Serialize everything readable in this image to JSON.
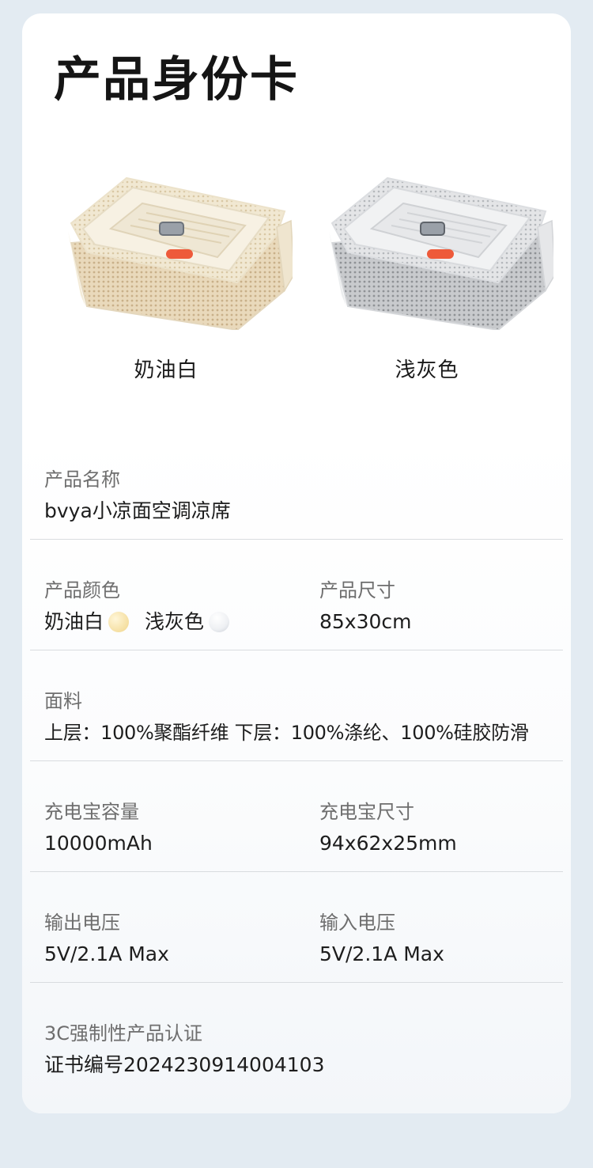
{
  "header": {
    "title": "产品身份卡"
  },
  "colors": {
    "page_bg": "#e3ebf2",
    "card_bg": "#ffffff",
    "cream_swatch": "#f5dfa2",
    "grey_swatch": "#e6e9ee",
    "button_orange": "#ee5a3a"
  },
  "products": [
    {
      "name": "奶油白",
      "image": "cream-cooling-mat-image"
    },
    {
      "name": "浅灰色",
      "image": "grey-cooling-mat-image"
    }
  ],
  "specs": {
    "product_name": {
      "label": "产品名称",
      "value": "bvya小凉面空调凉席"
    },
    "product_color": {
      "label": "产品颜色",
      "option1": "奶油白",
      "option2": "浅灰色"
    },
    "product_size": {
      "label": "产品尺寸",
      "value": "85x30cm"
    },
    "fabric": {
      "label": "面料",
      "value": "上层：100%聚酯纤维 下层：100%涤纶、100%硅胶防滑"
    },
    "battery_capacity": {
      "label": "充电宝容量",
      "value": "10000mAh"
    },
    "battery_size": {
      "label": "充电宝尺寸",
      "value": "94x62x25mm"
    },
    "output_voltage": {
      "label": "输出电压",
      "value": "5V/2.1A Max"
    },
    "input_voltage": {
      "label": "输入电压",
      "value": "5V/2.1A Max"
    },
    "certification": {
      "label": "3C强制性产品认证",
      "value": "证书编号2024230914004103"
    }
  }
}
